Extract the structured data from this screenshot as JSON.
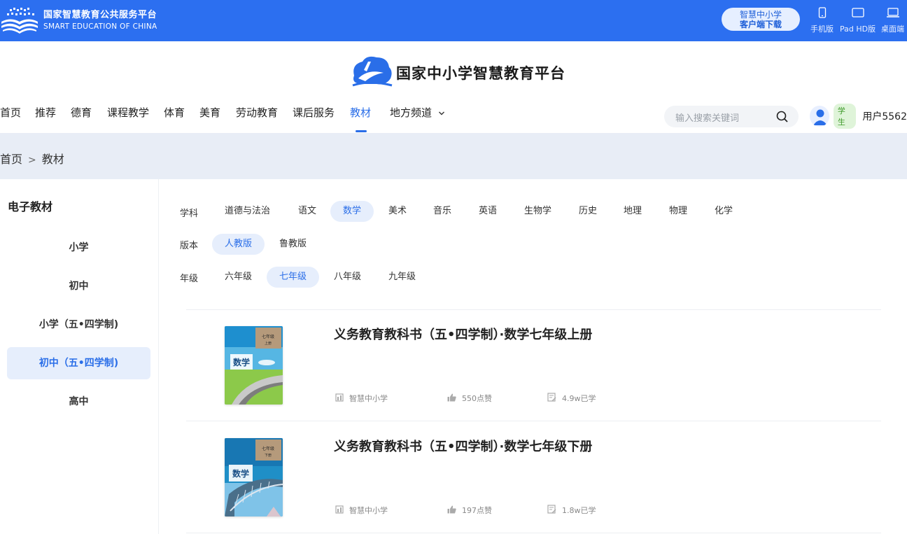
{
  "topbar": {
    "brand_cn": "国家智慧教育公共服务平台",
    "brand_en": "SMART EDUCATION OF CHINA",
    "download_line1": "智慧中小学",
    "download_line2": "客户端下载",
    "devices": [
      {
        "label": "手机版",
        "icon": "phone-icon"
      },
      {
        "label": "Pad HD版",
        "icon": "tablet-icon"
      },
      {
        "label": "桌面端",
        "icon": "laptop-icon"
      }
    ]
  },
  "header": {
    "site_title": "国家中小学智慧教育平台"
  },
  "nav": {
    "items": [
      "首页",
      "推荐",
      "德育",
      "课程教学",
      "体育",
      "美育",
      "劳动教育",
      "课后服务",
      "教材",
      "地方频道"
    ],
    "active": "教材"
  },
  "search": {
    "placeholder": "输入搜索关键词"
  },
  "user": {
    "role": "学生",
    "name": "用户5562"
  },
  "breadcrumb": {
    "home": "首页",
    "separator": ">",
    "current": "教材"
  },
  "sidebar": {
    "title": "电子教材",
    "items": [
      "小学",
      "初中",
      "小学（五•四学制)",
      "初中（五•四学制)",
      "高中"
    ],
    "active": "初中（五•四学制)"
  },
  "filters": {
    "subject_label": "学科",
    "subjects": [
      "道德与法治",
      "语文",
      "数学",
      "美术",
      "音乐",
      "英语",
      "生物学",
      "历史",
      "地理",
      "物理",
      "化学"
    ],
    "subject_active": "数学",
    "edition_label": "版本",
    "editions": [
      "人教版",
      "鲁教版"
    ],
    "edition_active": "人教版",
    "grade_label": "年级",
    "grades": [
      "六年级",
      "七年级",
      "八年级",
      "九年级"
    ],
    "grade_active": "七年级"
  },
  "books": [
    {
      "title": "义务教育教科书（五•四学制）·数学七年级上册",
      "publisher": "智慧中小学",
      "likes": "550点赞",
      "learned": "4.9w已学",
      "cover_word": "数学",
      "cover_grade": "七年级",
      "cover_volume": "上册"
    },
    {
      "title": "义务教育教科书（五•四学制）·数学七年级下册",
      "publisher": "智慧中小学",
      "likes": "197点赞",
      "learned": "1.8w已学",
      "cover_word": "数学",
      "cover_grade": "七年级",
      "cover_volume": "下册"
    }
  ],
  "colors": {
    "topbar": "#2c6ff0",
    "accent": "#2a6ee8",
    "active_bg": "#e6eefc",
    "band": "#e8edf6"
  }
}
